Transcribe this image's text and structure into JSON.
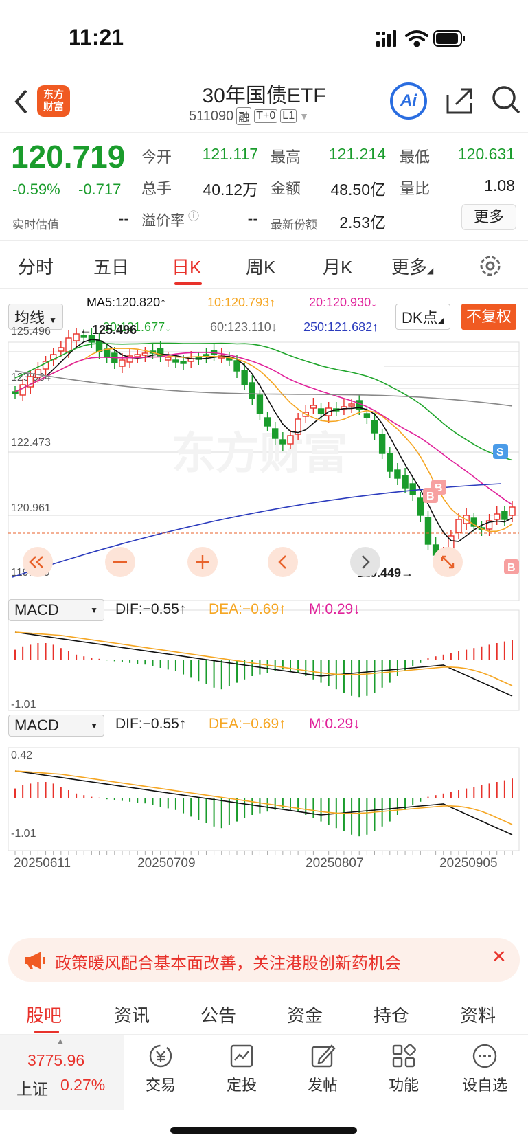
{
  "status_bar": {
    "time": "11:21"
  },
  "header": {
    "back_icon": "chevron-left-icon",
    "logo_text": [
      "东方",
      "财富"
    ],
    "title": "30年国债ETF",
    "code": "511090",
    "tags": [
      "融",
      "T+0",
      "L1"
    ],
    "ai_label": "Ai"
  },
  "quote": {
    "price": "120.719",
    "change_pct": "-0.59%",
    "change": "-0.717",
    "open_label": "今开",
    "open": "121.117",
    "high_label": "最高",
    "high": "121.214",
    "low_label": "最低",
    "low": "120.631",
    "volume_label": "总手",
    "volume": "40.12万",
    "amount_label": "金额",
    "amount": "48.50亿",
    "ratio_label": "量比",
    "ratio": "1.08",
    "iopv_label": "实时估值",
    "iopv": "--",
    "premium_label": "溢价率",
    "premium": "--",
    "shares_label": "最新份额",
    "shares": "2.53亿",
    "more_label": "更多"
  },
  "period_tabs": [
    "分时",
    "五日",
    "日K",
    "周K",
    "月K",
    "更多"
  ],
  "chart_controls": {
    "ma_select": "均线",
    "ma5": "MA5:120.820↑",
    "ma10": "10:120.793↑",
    "ma20": "20:120.930↓",
    "ma30": "30:121.677↓",
    "ma60": "60:123.110↓",
    "ma250": "250:121.682↑",
    "dk_label": "DK点",
    "fq_label": "不复权",
    "macd_select": "MACD",
    "dif": "DIF:−0.55↑",
    "dea": "DEA:−0.69↑",
    "m": "M:0.29↓",
    "watermark": "东方财富",
    "buy_marker": "B",
    "sell_marker": "S"
  },
  "chart_data": {
    "type": "candlestick",
    "y_ticks": [
      "125.496",
      "123.984",
      "122.473",
      "120.961",
      "119.449"
    ],
    "high_label": "←125.496",
    "low_label": "119.449→",
    "x_ticks": [
      "20250611",
      "20250709",
      "20250807",
      "20250905"
    ],
    "macd_ticks": [
      "0.42",
      "-1.01"
    ],
    "current_price": 120.719,
    "colors": {
      "up": "#e8322b",
      "down": "#1a9c2c",
      "ma5": "#111111",
      "ma10": "#f5a623",
      "ma20": "#e0219a",
      "ma30": "#1fa52b",
      "ma60": "#888888",
      "ma250": "#2b3bbd",
      "dea": "#f5a623"
    }
  },
  "banner": {
    "icon": "megaphone-icon",
    "text": "政策暖风配合基本面改善，关注港股创新药机会",
    "close_icon": "close-icon"
  },
  "bottom_tabs": [
    "股吧",
    "资讯",
    "公告",
    "资金",
    "持仓",
    "资料"
  ],
  "index": {
    "value": "3775.96",
    "name": "上证",
    "pct": "0.27%"
  },
  "toolbar": [
    {
      "label": "交易",
      "icon": "yuan-exchange-icon"
    },
    {
      "label": "定投",
      "icon": "chart-up-icon"
    },
    {
      "label": "发帖",
      "icon": "edit-icon"
    },
    {
      "label": "功能",
      "icon": "grid-icon"
    },
    {
      "label": "设自选",
      "icon": "more-icon"
    }
  ]
}
